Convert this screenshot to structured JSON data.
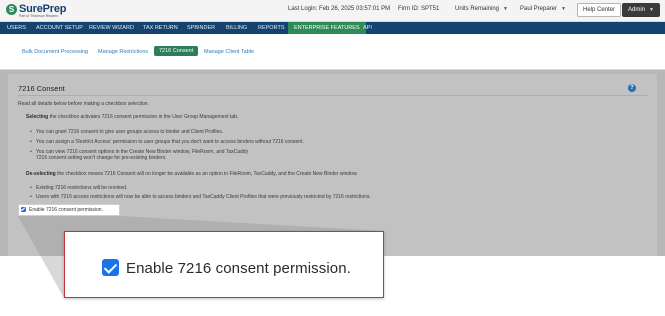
{
  "header": {
    "logo_badge": "S",
    "logo_text": "SurePrep",
    "logo_subtext": "Part of Thomson Reuters",
    "last_login": "Last Login: Feb 26, 2025 03:57:01 PM",
    "firm_id": "Firm ID:  SPT51",
    "units_remaining": "Units Remaining",
    "user_name": "Paul Preparer",
    "help_center": "Help Center",
    "admin": "Admin"
  },
  "nav": {
    "items": [
      {
        "label": "USERS"
      },
      {
        "label": "ACCOUNT SETUP"
      },
      {
        "label": "REVIEW WIZARD"
      },
      {
        "label": "TAX RETURN"
      },
      {
        "label": "SPBINDER"
      },
      {
        "label": "BILLING"
      },
      {
        "label": "REPORTS"
      },
      {
        "label": "ENTERPRISE FEATURES"
      },
      {
        "label": "API"
      }
    ],
    "active": "ENTERPRISE FEATURES"
  },
  "subnav": {
    "items": [
      {
        "label": "Bulk Document Processing"
      },
      {
        "label": "Manage Restrictions"
      },
      {
        "label": "7216 Consent"
      },
      {
        "label": "Manage Client Table"
      }
    ],
    "active": "7216 Consent"
  },
  "panel": {
    "title": "7216 Consent",
    "intro": "Read all details below before making a checkbox selection.",
    "selecting_bold": "Selecting",
    "selecting_rest": " the checkbox activates 7216 consent permission in the User Group Management tab.",
    "select_bullets": [
      "You can grant 7216 consent to give user groups access to binder and Client Profiles.",
      "You can assign a 'Restrict Access' permission to user groups that you don't want to access binders without 7216 consent.",
      "You can view 7216 consent options in the Create New Binder window, FileRoom, and TaxCaddy",
      "7216 consent setting won't change for pre-existing binders."
    ],
    "deselecting_bold": "De-selecting",
    "deselecting_rest": " the checkbox means 7216 Consent will no longer be available as an option in FileRoom, TaxCaddy, and the Create New Binder window.",
    "deselect_bullets": [
      "Existing 7216 restrictions will be revoked.",
      "Users with 7216 access restrictions will now be able to access binders and TaxCaddy Client Profiles that were previously restricted by 7216 restrictions."
    ],
    "checkbox_label": "Enable 7216 consent permission.",
    "checkbox_checked": true
  },
  "callout": {
    "label": "Enable 7216 consent permission.",
    "checked": true,
    "border_color": "#c4333c"
  },
  "colors": {
    "nav_bg": "#15436f",
    "nav_active": "#2e8b57",
    "subnav_active": "#2e7d5a",
    "link": "#2e7bbd",
    "checkbox": "#1a73e8",
    "help_icon": "#2a6bb8"
  }
}
